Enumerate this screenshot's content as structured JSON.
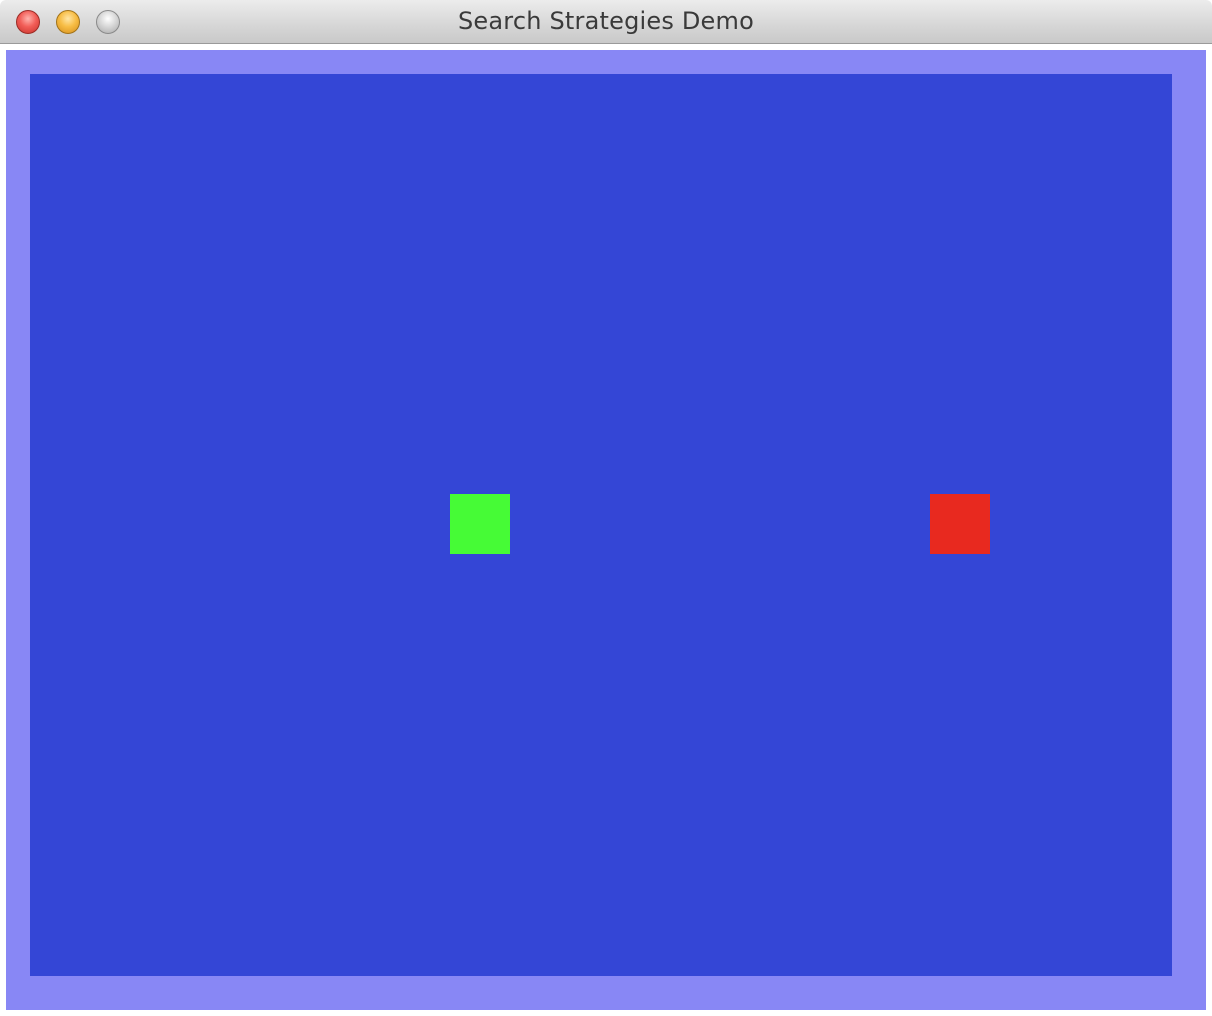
{
  "window": {
    "title": "Search Strategies Demo"
  },
  "colors": {
    "border": "#8887f5",
    "grid_background": "#3446d6",
    "start_cell": "#46fb36",
    "goal_cell": "#e8291f"
  },
  "icons": {
    "close": "close-traffic-light",
    "minimize": "minimize-traffic-light",
    "zoom": "zoom-traffic-light"
  }
}
